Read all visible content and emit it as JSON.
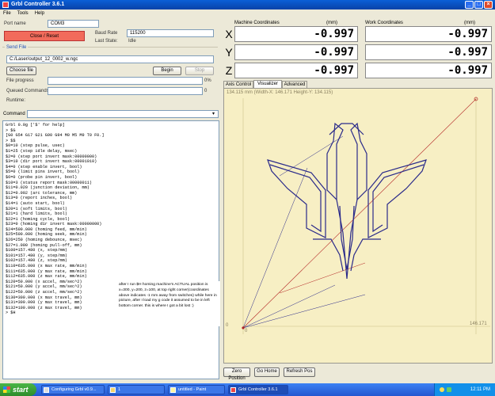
{
  "window": {
    "title": "Grbl Controller 3.6.1"
  },
  "menu": [
    "File",
    "Tools",
    "Help"
  ],
  "connection": {
    "port_label": "Port name",
    "port_value": "COM3",
    "baud_label": "Baud Rate",
    "baud_value": "115200",
    "reset_label": "Close / Reset",
    "state_label": "Last State:",
    "state_value": "Idle"
  },
  "send": {
    "title": "Send File",
    "file_path": "C:/Laser/output_12_0002_w.ngc",
    "choose_label": "Choose file",
    "begin_label": "Begin",
    "stop_label": "Stop",
    "progress_label": "File progress",
    "progress_value": "0%",
    "progress_fraction": 0,
    "queued_label": "Queued Commands",
    "queued_value": "0",
    "runtime_label": "Runtime:"
  },
  "command": {
    "label": "Command"
  },
  "console": {
    "lines": [
      "Grbl 0.9g ['$' for help]",
      "> $G",
      "[G0 G54 G17 G21 G90 G94 M0 M5 M9 T0 F0.]",
      "> $$",
      "$0=10 (step pulse, usec)",
      "$1=25 (step idle delay, msec)",
      "$2=0 (step port invert mask:00000000)",
      "$3=10 (dir port invert mask:00001010)",
      "$4=0 (step enable invert, bool)",
      "$5=0 (limit pins invert, bool)",
      "$6=0 (probe pin invert, bool)",
      "$10=3 (status report mask:00000011)",
      "$11=0.020 (junction deviation, mm)",
      "$12=0.002 (arc tolerance, mm)",
      "$13=0 (report inches, bool)",
      "$14=1 (auto start, bool)",
      "$20=1 (soft limits, bool)",
      "$21=1 (hard limits, bool)",
      "$22=1 (homing cycle, bool)",
      "$23=0 (homing dir invert mask:00000000)",
      "$24=500.000 (homing feed, mm/min)",
      "$25=500.000 (homing seek, mm/min)",
      "$26=250 (homing debounce, msec)",
      "$27=1.000 (homing pull-off, mm)",
      "$100=157.480 (x, step/mm)",
      "$101=157.480 (y, step/mm)",
      "$102=157.480 (z, step/mm)",
      "$110=635.000 (x max rate, mm/min)",
      "$111=635.000 (y max rate, mm/min)",
      "$112=635.000 (z max rate, mm/min)",
      "$120=50.000 (x accel, mm/sec^2)",
      "$121=50.000 (y accel, mm/sec^2)",
      "$122=50.000 (z accel, mm/sec^2)",
      "$130=300.000 (x max travel, mm)",
      "$131=300.000 (y max travel, mm)",
      "$132=100.000 (z max travel, mm)",
      "> $H"
    ]
  },
  "coords": {
    "machine_label": "Machine Coordinates",
    "work_label": "Work Coordinates",
    "unit": "(mm)",
    "axes": [
      {
        "name": "X",
        "machine": "-0.997",
        "work": "-0.997"
      },
      {
        "name": "Y",
        "machine": "-0.997",
        "work": "-0.997"
      },
      {
        "name": "Z",
        "machine": "-0.997",
        "work": "-0.997"
      }
    ]
  },
  "tabs": [
    "Axis Control",
    "Visualizer",
    "Advanced"
  ],
  "visualizer": {
    "header": "134.115 mm  (Width-X: 146.171  Height-Y: 134.115)",
    "origin_label": "0",
    "origin_label_y": "0",
    "x_max_label": "146.171",
    "annotation": "after I run $H homing machine's ACTUAL position is x=300, y=200, z=100, at top right corner(coordinates above indicates -1 mm away from switches) while here in picture, after I load my g code it assumed to be in left bottom corner. this is where I got a bit lost :)",
    "colors": {
      "background": "#f7efc4",
      "toolpath": "#2a2a8a",
      "move": "#b22222"
    }
  },
  "vizbuttons": {
    "zero": "Zero Position",
    "home": "Go Home",
    "refresh": "Refresh Pos"
  },
  "taskbar": {
    "start": "start",
    "tasks": [
      "Configuring Grbl v0.9...",
      "1",
      "untitled - Paint",
      "Grbl Controller 3.6.1"
    ],
    "clock": "12:11 PM"
  }
}
